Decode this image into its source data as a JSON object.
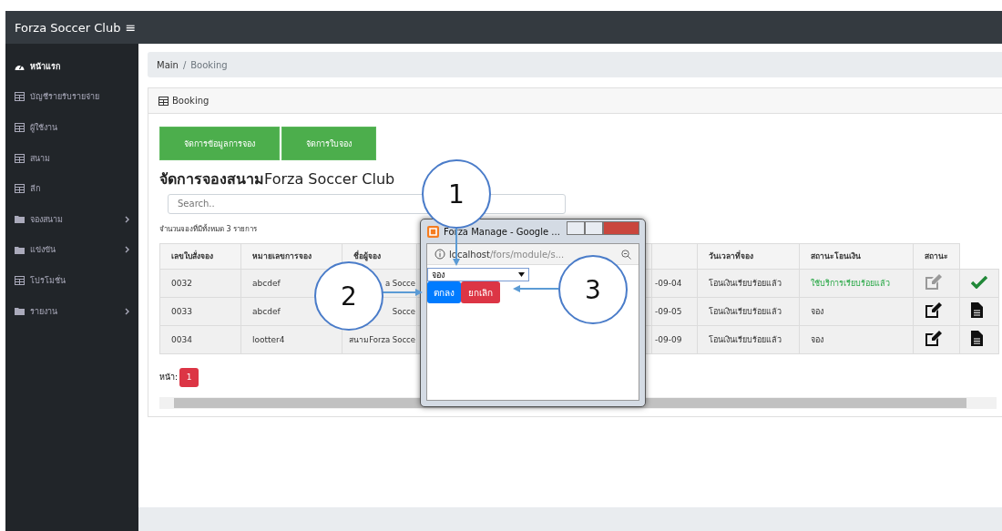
{
  "topbar": {
    "brand": "Forza Soccer Club",
    "menu_glyph": "≡"
  },
  "sidebar": {
    "items": [
      {
        "label": "หน้าแรก",
        "kind": "dashboard",
        "selected": true,
        "expandable": false
      },
      {
        "label": "บัญชีรายรับรายจ่าย",
        "kind": "table",
        "selected": false,
        "expandable": false
      },
      {
        "label": "ผู้ใช้งาน",
        "kind": "table",
        "selected": false,
        "expandable": false
      },
      {
        "label": "สนาม",
        "kind": "table",
        "selected": false,
        "expandable": false
      },
      {
        "label": "ลีก",
        "kind": "table",
        "selected": false,
        "expandable": false
      },
      {
        "label": "จองสนาม",
        "kind": "folder",
        "selected": false,
        "expandable": true
      },
      {
        "label": "แข่งขัน",
        "kind": "folder",
        "selected": false,
        "expandable": true
      },
      {
        "label": "โปรโมชั่น",
        "kind": "table",
        "selected": false,
        "expandable": false
      },
      {
        "label": "รายงาน",
        "kind": "folder",
        "selected": false,
        "expandable": true
      }
    ]
  },
  "breadcrumb": {
    "items": [
      "Main",
      "Booking"
    ],
    "separator": "/"
  },
  "card": {
    "title": "Booking",
    "buttons": [
      "จัดการข้อมูลการจอง",
      "จัดการใบจอง"
    ],
    "heading": {
      "bold": "จัดการจองสนาม",
      "rest": "Forza Soccer Club"
    },
    "search": {
      "placeholder": "Search.."
    },
    "count": "จำนวนจองที่มีทั้งหมด 3 รายการ",
    "table": {
      "columns": [
        "เลขใบสั่งจอง",
        "หมายเลขการจอง",
        "ชื่อผู้จอง",
        "",
        "",
        "วันเวลาที่จอง",
        "สถานะโอนเงิน",
        "สถานะ",
        ""
      ],
      "rows": [
        {
          "cells": [
            "0032",
            "abcdef",
            "a Socce",
            "",
            "-09-04",
            "โอนเงินเรียบร้อยแล้ว",
            "ใช้บริการเรียบร้อยแล้ว"
          ],
          "completed": true
        },
        {
          "cells": [
            "0033",
            "abcdef",
            "Socce",
            "",
            "-09-05",
            "โอนเงินเรียบร้อยแล้ว",
            "จอง"
          ],
          "completed": false
        },
        {
          "cells": [
            "0034",
            "lootter4",
            "สนามForza Socce",
            "",
            "-09-09",
            "โอนเงินเรียบร้อยแล้ว",
            "จอง"
          ],
          "completed": false
        }
      ]
    },
    "pagination": {
      "label": "หน้า:",
      "pages": [
        {
          "label": "1",
          "selected": true
        }
      ]
    }
  },
  "popup": {
    "title": "Forza Manage - Google ...",
    "url_host": "localhost",
    "url_path": "/fors/module/s...",
    "select_value": "จอง",
    "ok": "ตกลง",
    "cancel": "ยกเลิก"
  },
  "annotations": [
    {
      "label": "1"
    },
    {
      "label": "2"
    },
    {
      "label": "3"
    }
  ]
}
